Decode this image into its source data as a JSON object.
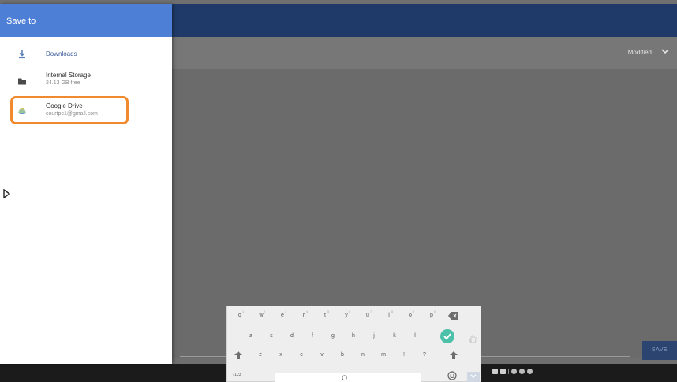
{
  "drawer": {
    "title": "Save to",
    "items": [
      {
        "label": "Downloads",
        "icon": "download-icon"
      },
      {
        "label": "Internal Storage",
        "sub": "24.13 GB free",
        "icon": "folder-icon"
      },
      {
        "label": "Google Drive",
        "sub": "courtpc1@gmail.com",
        "icon": "google-drive-icon"
      }
    ]
  },
  "toolbar": {
    "sort_label": "Modified",
    "save_label": "SAVE"
  },
  "keyboard": {
    "row1": [
      "q",
      "w",
      "e",
      "r",
      "t",
      "y",
      "u",
      "i",
      "o",
      "p"
    ],
    "row1_hints": [
      "1",
      "2",
      "3",
      "4",
      "5",
      "6",
      "7",
      "8",
      "9",
      "0"
    ],
    "row2": [
      "a",
      "s",
      "d",
      "f",
      "g",
      "h",
      "j",
      "k",
      "l"
    ],
    "row3": [
      "z",
      "x",
      "c",
      "v",
      "b",
      "n",
      "m",
      "!",
      "?"
    ],
    "mode_key": "?123",
    "space_text": "O"
  },
  "colors": {
    "accent": "#4d7fd6",
    "appbar": "#1f3a68",
    "highlight": "#f08a2c",
    "check": "#4cc0a8"
  }
}
